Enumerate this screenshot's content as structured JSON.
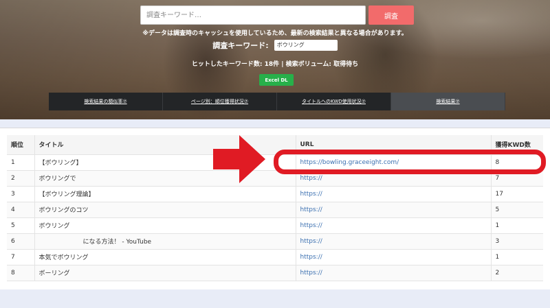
{
  "search": {
    "placeholder": "調査キーワード…",
    "button_label": "調査"
  },
  "notice": "※データは調査時のキャッシュを使用しているため、最新の検索結果と異なる場合があります。",
  "keyword": {
    "label": "調査キーワード:",
    "value": "ボウリング"
  },
  "hits_text": "ヒットしたキーワード数: 18件 | 検索ボリューム: 取得待ち",
  "excel_label": "Excel DL",
  "tabs": [
    {
      "label": "検索結果の類似率⑦"
    },
    {
      "label": "ページ別：順位獲得状況⑦"
    },
    {
      "label": "タイトルへのKWD使用状況⑦"
    },
    {
      "label": "検索結果⑦"
    }
  ],
  "table": {
    "headers": {
      "rank": "順位",
      "title": "タイトル",
      "url": "URL",
      "kwd": "獲得KWD数"
    },
    "rows": [
      {
        "rank": "1",
        "title": "【ボウリング】",
        "url": "https://bowling.graceeight.com/",
        "kwd": "8"
      },
      {
        "rank": "2",
        "title": "ボウリングで",
        "url": "https://",
        "kwd": "7"
      },
      {
        "rank": "3",
        "title": "【ボウリング理論】",
        "url": "https://",
        "kwd": "17"
      },
      {
        "rank": "4",
        "title": "ボウリングのコツ",
        "url": "https://",
        "kwd": "5"
      },
      {
        "rank": "5",
        "title": "ボウリング",
        "url": "https://",
        "kwd": "1"
      },
      {
        "rank": "6",
        "title": "になる方法！ - YouTube",
        "url": "https://",
        "kwd": "3"
      },
      {
        "rank": "7",
        "title": "本気でボウリング",
        "url": "https://",
        "kwd": "1"
      },
      {
        "rank": "8",
        "title": "ボーリング",
        "url": "https://",
        "kwd": "2"
      }
    ]
  },
  "colors": {
    "search_button": "#f26b6b",
    "excel_button": "#27b04a",
    "tab_bg": "#232527",
    "tab_active_bg": "#4a4d51",
    "annotation_red": "#e01b24",
    "link": "#3a6fb0"
  }
}
